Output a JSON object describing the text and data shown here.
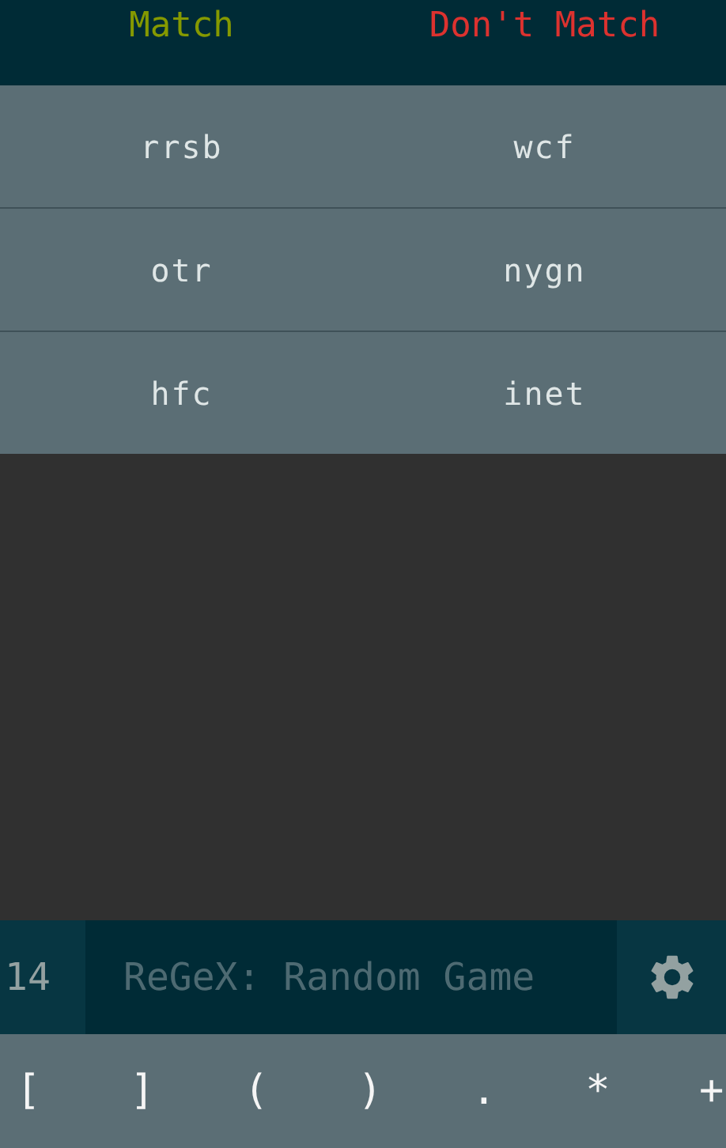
{
  "columns": [
    {
      "label": "Match",
      "kind": "match"
    },
    {
      "label": "Don't Match",
      "kind": "nomatch"
    }
  ],
  "rows": [
    [
      "rrsb",
      "wcf"
    ],
    [
      "otr",
      "nygn"
    ],
    [
      "hfc",
      "inet"
    ]
  ],
  "score": "14",
  "regex_input": {
    "placeholder": "ReGeX: Random Game"
  },
  "keys": [
    "[",
    "]",
    "(",
    ")",
    ".",
    "*",
    "+"
  ]
}
